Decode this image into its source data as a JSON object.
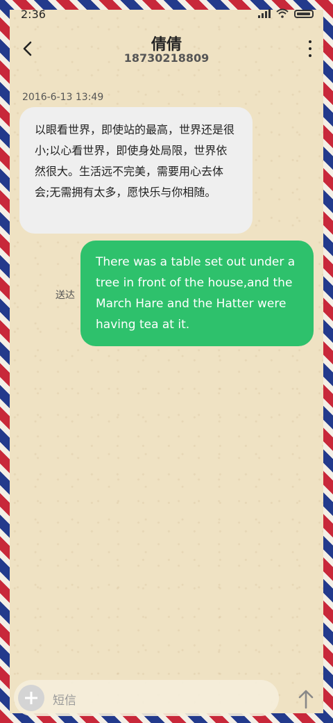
{
  "status_bar": {
    "time": "2:36"
  },
  "header": {
    "title": "倩倩",
    "subtitle": "18730218809"
  },
  "conversation": {
    "timestamp": "2016-6-13 13:49",
    "incoming_message": "以眼看世界，即使站的最高，世界还是很小;以心看世界，即使身处局限，世界依然很大。生活远不完美，需要用心去体会;无需拥有太多，愿快乐与你相随。",
    "outgoing_message": "There was a table set out under a tree in front of the house,and the March Hare and the Hatter were having tea at it.",
    "outgoing_status": "送达"
  },
  "composer": {
    "placeholder": "短信"
  },
  "icons": {
    "back": "chevron-left-icon",
    "more": "more-vertical-icon",
    "add": "plus-icon",
    "send": "arrow-up-icon",
    "signal": "signal-icon",
    "wifi": "wifi-icon",
    "battery": "battery-icon"
  },
  "colors": {
    "outgoing_bubble": "#2ec16c",
    "incoming_bubble": "#efefef",
    "paper": "#efe2c3",
    "stripe_red": "#c8283a",
    "stripe_blue": "#233a8c"
  }
}
